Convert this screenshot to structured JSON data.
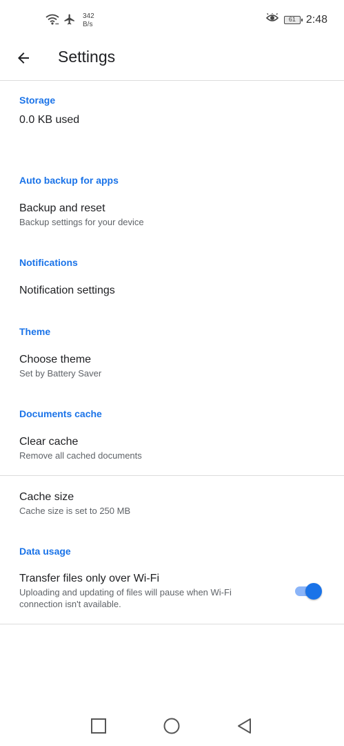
{
  "status_bar": {
    "net_speed_value": "342",
    "net_speed_unit": "B/s",
    "battery_level": "61",
    "time": "2:48"
  },
  "app_bar": {
    "title": "Settings"
  },
  "sections": {
    "storage": {
      "header": "Storage",
      "value": "0.0 KB used"
    },
    "backup": {
      "header": "Auto backup for apps",
      "title": "Backup and reset",
      "subtitle": "Backup settings for your device"
    },
    "notifications": {
      "header": "Notifications",
      "title": "Notification settings"
    },
    "theme": {
      "header": "Theme",
      "title": "Choose theme",
      "subtitle": "Set by Battery Saver"
    },
    "cache": {
      "header": "Documents cache",
      "clear_title": "Clear cache",
      "clear_subtitle": "Remove all cached documents",
      "size_title": "Cache size",
      "size_subtitle": "Cache size is set to 250 MB"
    },
    "data_usage": {
      "header": "Data usage",
      "title": "Transfer files only over Wi-Fi",
      "subtitle_line1": "Uploading and updating of files will pause when Wi-Fi",
      "subtitle_line2": "connection isn't available.",
      "toggle_on": true
    }
  },
  "colors": {
    "accent": "#1a73e8",
    "toggle_track": "#8ab4f8"
  },
  "icons": {
    "status_left": [
      "wifi-icon",
      "airplane-icon"
    ],
    "status_right": [
      "eye-icon",
      "battery-icon"
    ],
    "back": "arrow-left-icon",
    "nav": [
      "square-recents-icon",
      "circle-home-icon",
      "triangle-back-icon"
    ]
  }
}
